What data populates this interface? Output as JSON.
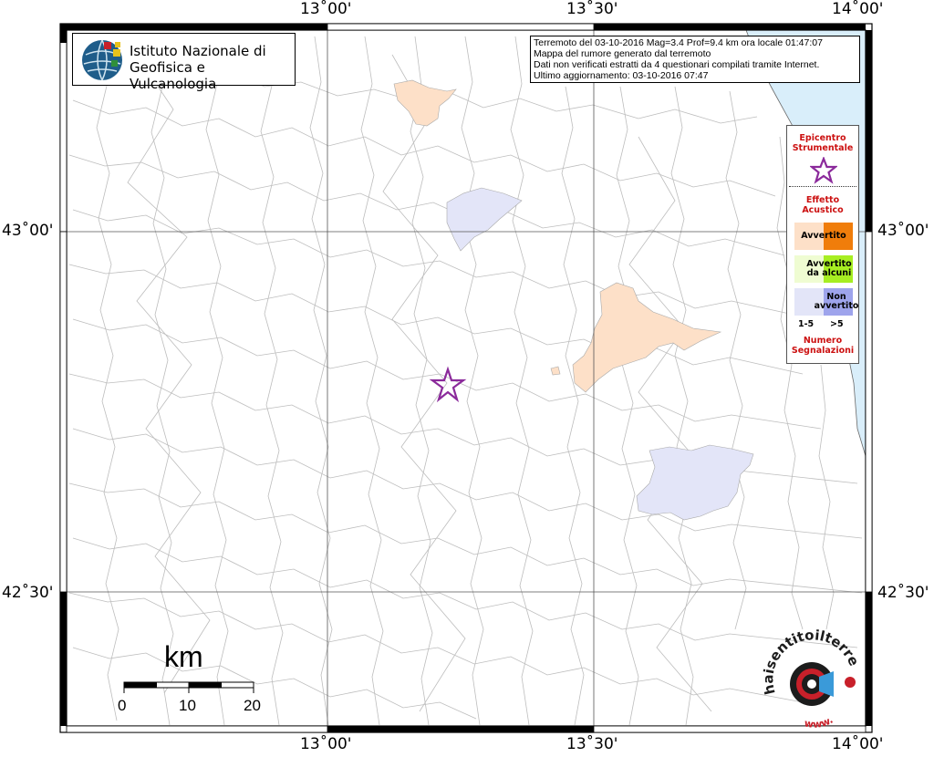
{
  "map": {
    "lon_ticks": [
      "13˚00'",
      "13˚30'",
      "14˚00'"
    ],
    "lat_ticks": [
      "43˚00'",
      "42˚30'"
    ],
    "colors": {
      "sea": "#d9eefa",
      "avvertito": "#fde0c8",
      "non_avvertito": "#e3e5f8",
      "border_lines": "#bdbdbd",
      "star": "#8b2a9b"
    }
  },
  "info": {
    "line1": "Terremoto del 03-10-2016 Mag=3.4 Prof=9.4 km ora locale 01:47:07",
    "line2": "Mappa del rumore generato dal terremoto",
    "line3": "Dati non verificati estratti da 4 questionari compilati tramite Internet.",
    "line4": "Ultimo aggiornamento: 03-10-2016 07:47"
  },
  "logo": {
    "line1": "Istituto Nazionale di",
    "line2": "Geofisica e Vulcanologia"
  },
  "legend": {
    "epicentro": "Epicentro Strumentale",
    "effetto": "Effetto Acustico",
    "avvertito": "Avvertito",
    "avvertito_alcuni": "Avvertito da alcuni",
    "non_avvertito": "Non avvertito",
    "range_low": "1-5",
    "range_high": ">5",
    "numero": "Numero Segnalazioni",
    "colors": {
      "avvertito_low": "#fde0c8",
      "avvertito_high": "#f07d0b",
      "alcuni_low": "#effcd2",
      "alcuni_high": "#a7ee22",
      "non_low": "#e3e5f8",
      "non_high": "#9ea4ec"
    }
  },
  "scale": {
    "unit": "km",
    "labels": [
      "0",
      "10",
      "20"
    ]
  },
  "brand": {
    "text": "haisentitoilterremoto.it",
    "prefix": "www."
  }
}
